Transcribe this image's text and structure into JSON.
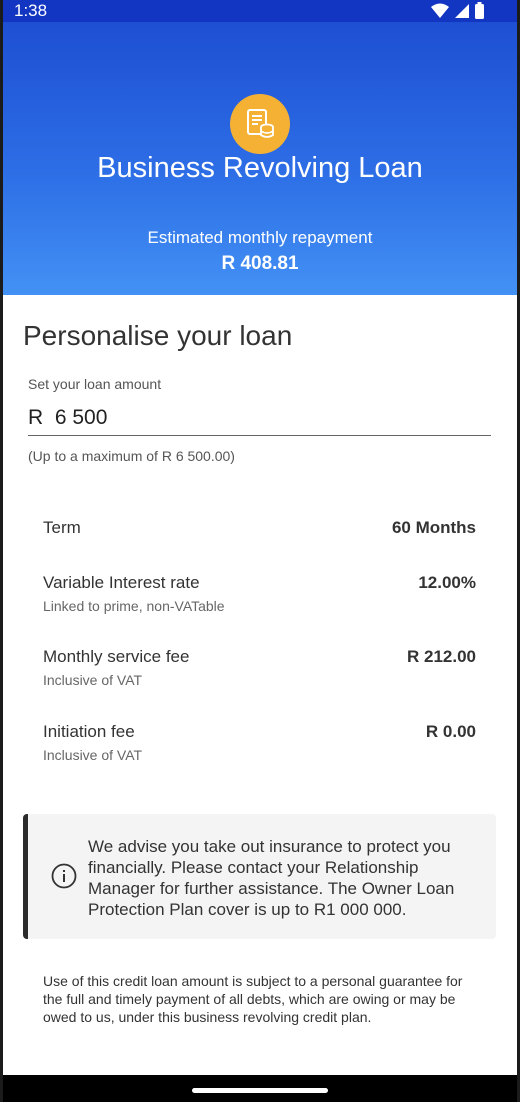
{
  "status_bar": {
    "time": "1:38"
  },
  "header": {
    "title": "Business Revolving Loan",
    "estimate_label": "Estimated monthly repayment",
    "estimate_value": "R 408.81"
  },
  "personalise": {
    "title": "Personalise your loan",
    "amount_label": "Set your loan amount",
    "amount_value": "R  6 500",
    "amount_hint": "(Up to a maximum of R 6 500.00)"
  },
  "details": [
    {
      "label": "Term",
      "sub": "",
      "value": "60 Months"
    },
    {
      "label": "Variable Interest rate",
      "sub": "Linked to prime, non-VATable",
      "value": "12.00%"
    },
    {
      "label": "Monthly service fee",
      "sub": "Inclusive of VAT",
      "value": "R 212.00"
    },
    {
      "label": "Initiation fee",
      "sub": "Inclusive of VAT",
      "value": "R 0.00"
    }
  ],
  "notice": {
    "icon": "info-icon",
    "text": "We advise you take out insurance to protect you financially. Please contact your Relationship Manager for further assistance. The Owner Loan Protection Plan cover is up to R1 000 000."
  },
  "disclaimer": "Use of this credit loan amount is subject to a personal guarantee for the full and timely payment of all debts, which are owing or may be owed to us, under this business revolving credit plan.",
  "colors": {
    "header_top": "#1e4fd3",
    "header_bottom": "#4391f5",
    "logo_badge": "#f5b133"
  }
}
